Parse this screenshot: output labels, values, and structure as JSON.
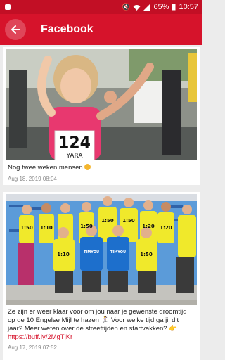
{
  "status_bar": {
    "time": "10:57",
    "battery": "65%",
    "icons": [
      "mute-icon",
      "wifi-icon",
      "signal-icon",
      "battery-icon"
    ]
  },
  "app_bar": {
    "title": "Facebook",
    "back_icon": "arrow-left-icon",
    "color": "#d6132b"
  },
  "posts": [
    {
      "image_alt": "Young girl with bib number 124 smiling during a kids run",
      "bib_number": "124",
      "bib_name": "YARA",
      "text": "Nog twee weken mensen",
      "emoji": "🥰",
      "date": "Aug 18, 2019 08:04"
    },
    {
      "image_alt": "Group of pacers in yellow and blue shirts in a shoe store",
      "text_main": "Ze zijn er weer klaar voor om jou naar je gewenste droomtijd op de 10 Engelse Mijl te hazen",
      "emoji_run": "🏃‍♀️",
      "text_rest": "Voor welke tijd ga jij dit jaar? Meer weten over de streeftijden en startvakken?",
      "emoji_point": "👉",
      "link": "https://buff.ly/2MgTjKr",
      "date": "Aug 17, 2019 07:52",
      "shirt_labels": [
        "1:50",
        "1:10",
        "1:50",
        "1:50",
        "1:50",
        "1:20",
        "1:20",
        "1:10",
        "1:50"
      ],
      "brand": "TIMYOU"
    }
  ]
}
